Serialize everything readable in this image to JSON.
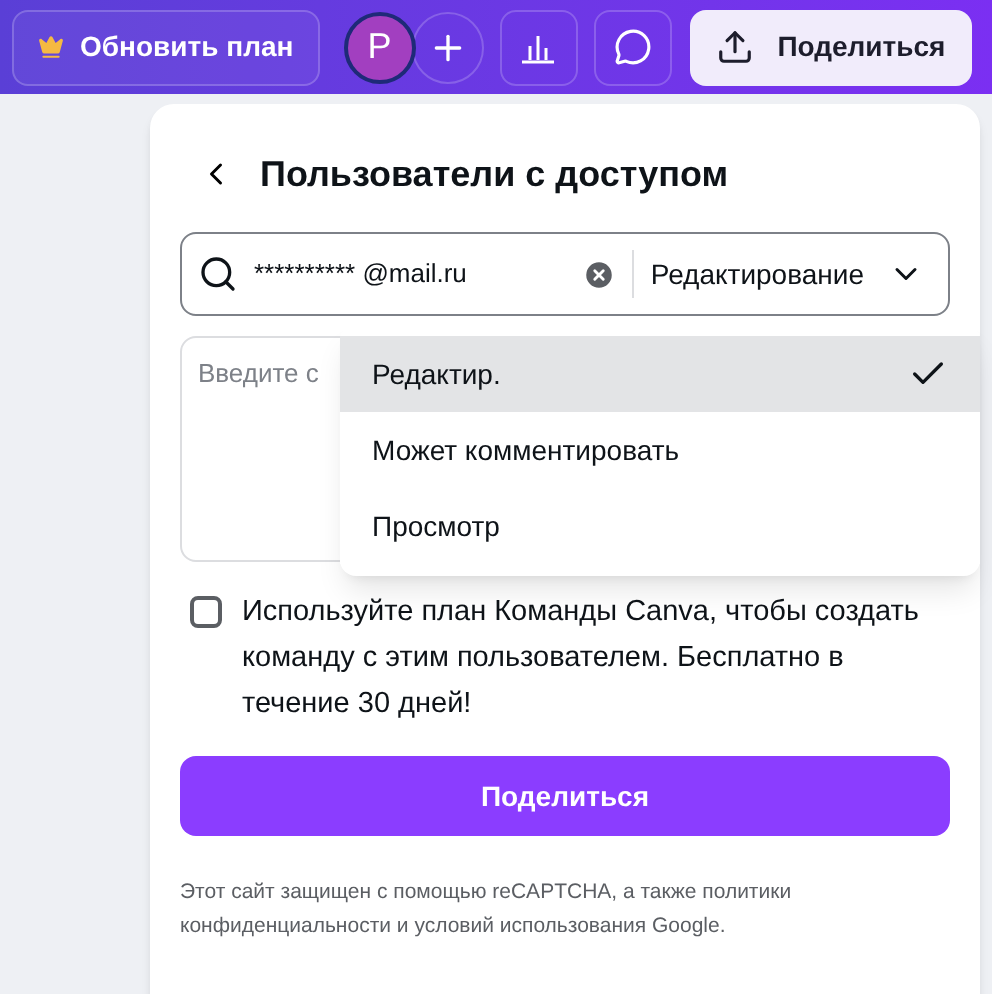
{
  "topbar": {
    "upgrade_button": "Обновить план",
    "avatar": "P",
    "share_button": "Поделиться"
  },
  "panel": {
    "title": "Пользователи с доступом",
    "search": {
      "value": "********** @mail.ru",
      "permission": "Редактирование"
    },
    "message": {
      "placeholder": "Введите с"
    },
    "team_option": {
      "checked": false,
      "label": "Используйте план Команды Canva, чтобы создать команду с этим пользователем. Бесплатно в течение 30 дней!"
    },
    "share_button": "Поделиться",
    "footer": "Этот сайт защищен с помощью reCAPTCHA, а также политики конфиденциальности и условий использования Google."
  },
  "permission_menu": [
    {
      "label": "Редактир.",
      "selected": true
    },
    {
      "label": "Может комментировать",
      "selected": false
    },
    {
      "label": "Просмотр",
      "selected": false
    }
  ]
}
